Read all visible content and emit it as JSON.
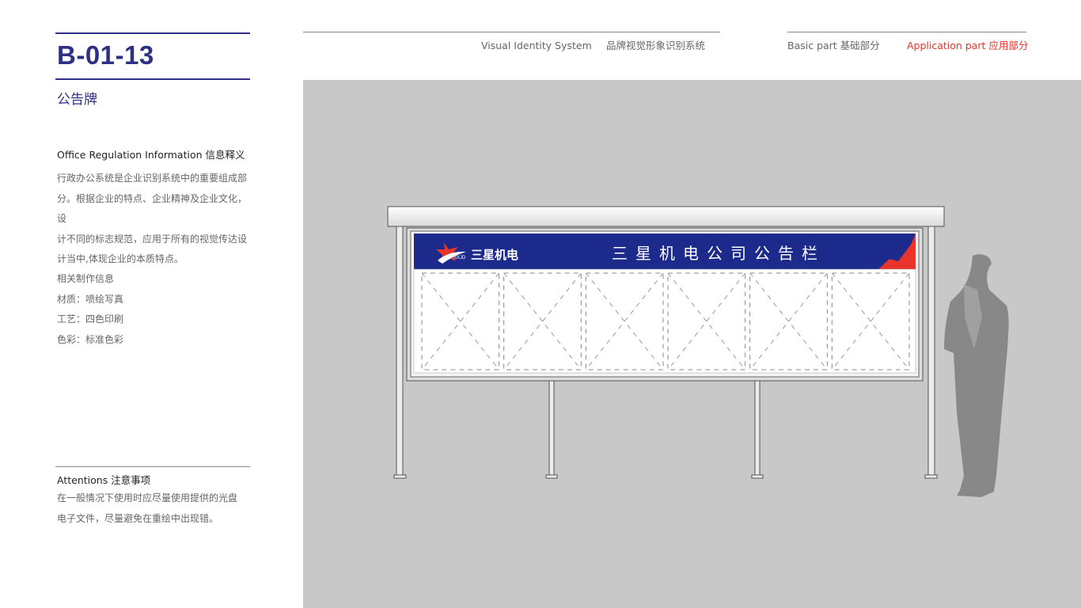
{
  "sidebar": {
    "code": "B-01-13",
    "title": "公告牌",
    "info_heading": "Office Regulation Information  信息释义",
    "description": [
      "行政办公系统是企业识别系统中的重要组成部",
      "分。根据企业的特点、企业精神及企业文化，设",
      "计不同的标志规范，应用于所有的视觉传达设",
      "计当中,体现企业的本质特点。"
    ],
    "production_info": [
      "相关制作信息",
      "材质：喷绘写真",
      "工艺：四色印刷",
      "色彩：标准色彩"
    ],
    "attentions_heading": "Attentions 注意事项",
    "attentions_text": [
      "在一般情况下使用时应尽量使用提供的光盘",
      "电子文件，尽量避免在重绘中出现错。"
    ]
  },
  "header": {
    "vis_en": "Visual Identity System",
    "vis_cn": "品牌视觉形象识别系统",
    "basic_part": "Basic part  基础部分",
    "application_part": "Application part  应用部分"
  },
  "board": {
    "logo_text": "三星机电",
    "logo_sub": "SXJD",
    "board_title": "三星机电公司公告栏",
    "panel_count": 6
  },
  "colors": {
    "brand_blue": "#2e2f86",
    "banner_blue": "#1c2a8c",
    "accent_red": "#e8342a",
    "scene_grey": "#c8c8c8",
    "silhouette": "#888888"
  }
}
